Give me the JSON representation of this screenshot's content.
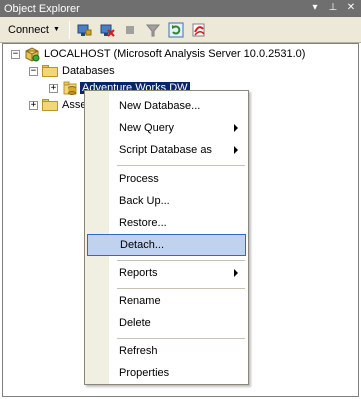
{
  "window": {
    "title": "Object Explorer",
    "pin_glyph": "▾ ⊥",
    "close_glyph": "✕"
  },
  "toolbar": {
    "connect_label": "Connect",
    "icons": [
      "connect-icon",
      "disconnect-icon",
      "stop-icon",
      "filter-icon",
      "refresh-icon",
      "sync-icon"
    ]
  },
  "tree": {
    "server_label": "LOCALHOST (Microsoft Analysis Server 10.0.2531.0)",
    "databases_label": "Databases",
    "selected_db_label": "Adventure Works DW",
    "assemblies_label": "Asse"
  },
  "context_menu": {
    "items": [
      {
        "label": "New Database..."
      },
      {
        "label": "New Query"
      },
      {
        "label": "Script Database as"
      },
      {
        "label": "Process"
      },
      {
        "label": "Back Up..."
      },
      {
        "label": "Restore..."
      },
      {
        "label": "Detach..."
      },
      {
        "label": "Reports"
      },
      {
        "label": "Rename"
      },
      {
        "label": "Delete"
      },
      {
        "label": "Refresh"
      },
      {
        "label": "Properties"
      }
    ],
    "highlighted": "Detach..."
  },
  "colors": {
    "title_bar": "#6f6f6f",
    "toolbar": "#ece9d8",
    "selection": "#0a246a",
    "menu_highlight": "#c1d2ee"
  }
}
